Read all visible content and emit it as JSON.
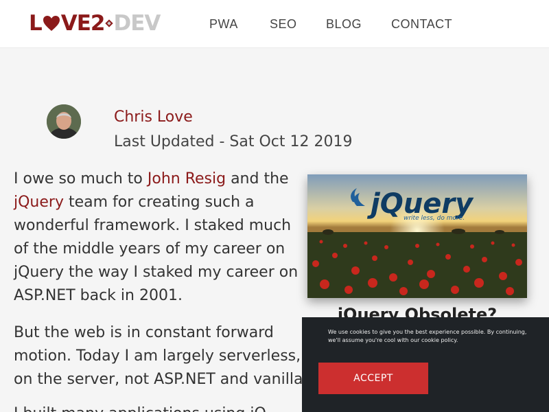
{
  "header": {
    "logo": {
      "part1": "L",
      "part2": "VE2",
      "part3": "DEV"
    },
    "nav": [
      "PWA",
      "SEO",
      "BLOG",
      "CONTACT"
    ]
  },
  "author": {
    "name": "Chris Love",
    "updated": "Last Updated - Sat Oct 12 2019"
  },
  "article": {
    "p1": {
      "t1": "I owe so much to ",
      "link1": "John Resig",
      "t2": " and the ",
      "link2": "jQuery",
      "t3": " team for creating such a wonderful framework. I staked much of the middle years of my career on jQuery the way I staked my career on ASP.NET back in 2001."
    },
    "p2": {
      "line1": "But the web is in constant forward",
      "line2": "motion. Today I am largely serverless, lea",
      "line3": "on the server, not ASP.NET and vanilla Jav"
    },
    "p3": "I built many applications using jQ",
    "feature": {
      "logo_text": "jQuery",
      "tagline": "write less, do more.",
      "caption": "jQuery Obsolete?"
    }
  },
  "cookie": {
    "text": "We use cookies to give you the best experience possible. By continuing, we'll assume you're cool with our cookie policy.",
    "accept": "ACCEPT"
  },
  "colors": {
    "brand": "#8b1a1a",
    "accept_button": "#cc2f2f",
    "cookie_bg": "#1f2327"
  }
}
